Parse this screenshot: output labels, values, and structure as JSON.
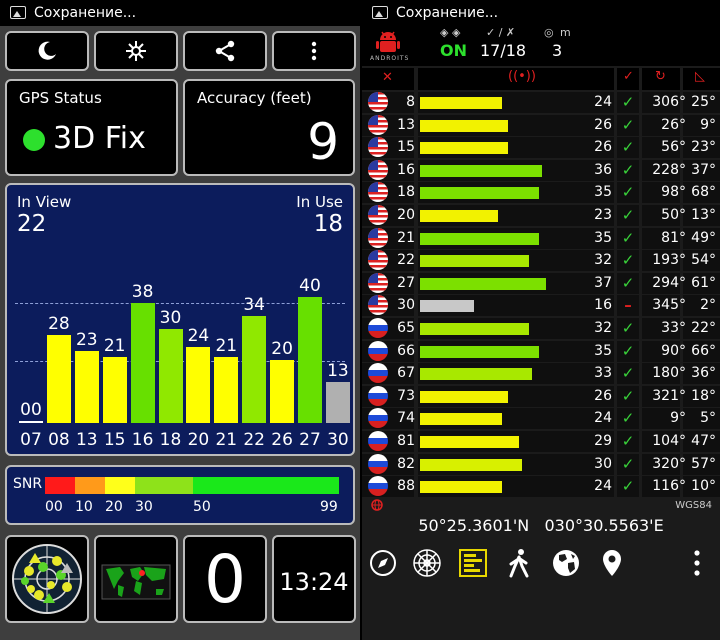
{
  "status_text": "Сохранение...",
  "left": {
    "toolbar": [
      "night-mode-icon",
      "brightness-icon",
      "share-icon",
      "more-vert-icon"
    ],
    "gps_status": {
      "label": "GPS Status",
      "value": "3D Fix",
      "indicator_color": "#2de02d"
    },
    "accuracy": {
      "label": "Accuracy (feet)",
      "value": "9"
    },
    "sky": {
      "in_view_label": "In View",
      "in_view": "22",
      "in_use_label": "In Use",
      "in_use": "18",
      "prns": [
        "07",
        "08",
        "13",
        "15",
        "16",
        "18",
        "20",
        "21",
        "22",
        "26",
        "27",
        "30"
      ],
      "snrs": [
        "00",
        "28",
        "23",
        "21",
        "38",
        "30",
        "24",
        "21",
        "34",
        "20",
        "40",
        "13"
      ],
      "snr_values": [
        0,
        28,
        23,
        21,
        38,
        30,
        24,
        21,
        34,
        20,
        40,
        13
      ],
      "bar_colors": [
        "#ffffff",
        "#ffff00",
        "#ffff00",
        "#ffff00",
        "#67e000",
        "#90e800",
        "#ffff00",
        "#ffff00",
        "#90e800",
        "#ffff00",
        "#67e000",
        "#b0b0b0"
      ]
    },
    "snr_legend": {
      "label": "SNR",
      "ticks": [
        "00",
        "10",
        "20",
        "30",
        "50",
        "99"
      ]
    },
    "bottom": {
      "count": "0",
      "time": "13:24"
    }
  },
  "right": {
    "header": {
      "on": "ON",
      "ratio": "17/18",
      "count": "3",
      "m_label": "m",
      "brand": "ANDROITS"
    },
    "rows": [
      {
        "flag": "us",
        "prn": "8",
        "snr": "24",
        "snrv": 24,
        "check": "✓",
        "az": "306°",
        "el": "25°",
        "color": "#f2f200"
      },
      {
        "flag": "us",
        "prn": "13",
        "snr": "26",
        "snrv": 26,
        "check": "✓",
        "az": "26°",
        "el": "9°",
        "color": "#f2f200"
      },
      {
        "flag": "us",
        "prn": "15",
        "snr": "26",
        "snrv": 26,
        "check": "✓",
        "az": "56°",
        "el": "23°",
        "color": "#f2f200"
      },
      {
        "flag": "us",
        "prn": "16",
        "snr": "36",
        "snrv": 36,
        "check": "✓",
        "az": "228°",
        "el": "37°",
        "color": "#7ce000"
      },
      {
        "flag": "us",
        "prn": "18",
        "snr": "35",
        "snrv": 35,
        "check": "✓",
        "az": "98°",
        "el": "68°",
        "color": "#7ce000"
      },
      {
        "flag": "us",
        "prn": "20",
        "snr": "23",
        "snrv": 23,
        "check": "✓",
        "az": "50°",
        "el": "13°",
        "color": "#f2f200"
      },
      {
        "flag": "us",
        "prn": "21",
        "snr": "35",
        "snrv": 35,
        "check": "✓",
        "az": "81°",
        "el": "49°",
        "color": "#7ce000"
      },
      {
        "flag": "us",
        "prn": "22",
        "snr": "32",
        "snrv": 32,
        "check": "✓",
        "az": "193°",
        "el": "54°",
        "color": "#a8e800"
      },
      {
        "flag": "us",
        "prn": "27",
        "snr": "37",
        "snrv": 37,
        "check": "✓",
        "az": "294°",
        "el": "61°",
        "color": "#7ce000"
      },
      {
        "flag": "us",
        "prn": "30",
        "snr": "16",
        "snrv": 16,
        "check": "–",
        "az": "345°",
        "el": "2°",
        "color": "#c8c8c8"
      },
      {
        "flag": "ru",
        "prn": "65",
        "snr": "32",
        "snrv": 32,
        "check": "✓",
        "az": "33°",
        "el": "22°",
        "color": "#a8e800"
      },
      {
        "flag": "ru",
        "prn": "66",
        "snr": "35",
        "snrv": 35,
        "check": "✓",
        "az": "90°",
        "el": "66°",
        "color": "#7ce000"
      },
      {
        "flag": "ru",
        "prn": "67",
        "snr": "33",
        "snrv": 33,
        "check": "✓",
        "az": "180°",
        "el": "36°",
        "color": "#a8e800"
      },
      {
        "flag": "ru",
        "prn": "73",
        "snr": "26",
        "snrv": 26,
        "check": "✓",
        "az": "321°",
        "el": "18°",
        "color": "#f2f200"
      },
      {
        "flag": "ru",
        "prn": "74",
        "snr": "24",
        "snrv": 24,
        "check": "✓",
        "az": "9°",
        "el": "5°",
        "color": "#f2f200"
      },
      {
        "flag": "ru",
        "prn": "81",
        "snr": "29",
        "snrv": 29,
        "check": "✓",
        "az": "104°",
        "el": "47°",
        "color": "#f2f200"
      },
      {
        "flag": "ru",
        "prn": "82",
        "snr": "30",
        "snrv": 30,
        "check": "✓",
        "az": "320°",
        "el": "57°",
        "color": "#d8f000"
      },
      {
        "flag": "ru",
        "prn": "88",
        "snr": "24",
        "snrv": 24,
        "check": "✓",
        "az": "116°",
        "el": "10°",
        "color": "#f2f200"
      }
    ],
    "datum": "WGS84",
    "lat": "50°25.3601'N",
    "lon": "030°30.5563'E",
    "bottom_icons": [
      "compass-icon",
      "radar-icon",
      "bars-icon",
      "walk-icon",
      "globe-icon",
      "pin-icon",
      "more-vert-icon"
    ]
  }
}
